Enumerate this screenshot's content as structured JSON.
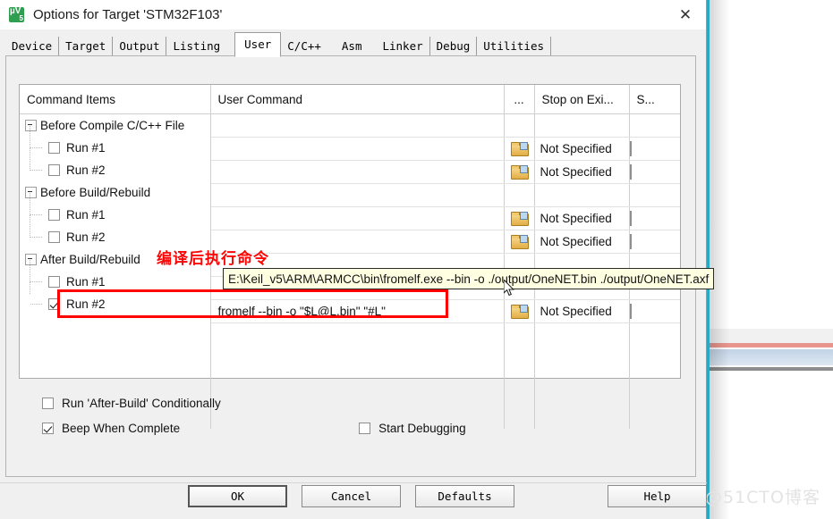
{
  "window": {
    "title": "Options for Target 'STM32F103'",
    "app_icon": "keil-uvision5-icon",
    "close_label": "✕"
  },
  "tabs": [
    {
      "label": "Device",
      "active": false
    },
    {
      "label": "Target",
      "active": false
    },
    {
      "label": "Output",
      "active": false
    },
    {
      "label": "Listing",
      "active": false
    },
    {
      "label": "User",
      "active": true
    },
    {
      "label": "C/C++",
      "active": false
    },
    {
      "label": "Asm",
      "active": false
    },
    {
      "label": "Linker",
      "active": false
    },
    {
      "label": "Debug",
      "active": false
    },
    {
      "label": "Utilities",
      "active": false
    }
  ],
  "grid": {
    "headers": {
      "command_items": "Command Items",
      "user_command": "User Command",
      "dots": "...",
      "stop_on_exit": "Stop on Exi...",
      "s_column": "S..."
    },
    "rows": [
      {
        "type": "group",
        "label": "Before Compile C/C++ File",
        "command": "",
        "stop": "",
        "has_folder": false,
        "checked": false,
        "s_checked": false
      },
      {
        "type": "child",
        "label": "Run #1",
        "command": "",
        "stop": "Not Specified",
        "has_folder": true,
        "checked": false,
        "s_checked": false
      },
      {
        "type": "child",
        "label": "Run #2",
        "command": "",
        "stop": "Not Specified",
        "has_folder": true,
        "checked": false,
        "s_checked": false
      },
      {
        "type": "group",
        "label": "Before Build/Rebuild",
        "command": "",
        "stop": "",
        "has_folder": false,
        "checked": false,
        "s_checked": false
      },
      {
        "type": "child",
        "label": "Run #1",
        "command": "",
        "stop": "Not Specified",
        "has_folder": true,
        "checked": false,
        "s_checked": false
      },
      {
        "type": "child",
        "label": "Run #2",
        "command": "",
        "stop": "Not Specified",
        "has_folder": true,
        "checked": false,
        "s_checked": false
      },
      {
        "type": "group",
        "label": "After Build/Rebuild",
        "command": "",
        "stop": "",
        "has_folder": false,
        "checked": false,
        "s_checked": false
      },
      {
        "type": "child",
        "label": "Run #1",
        "command": "",
        "stop": "",
        "has_folder": false,
        "checked": false,
        "s_checked": false
      },
      {
        "type": "child",
        "label": "Run #2",
        "command": "fromelf --bin -o \"$L@L.bin\" \"#L\"",
        "stop": "Not Specified",
        "has_folder": true,
        "checked": true,
        "s_checked": false
      }
    ]
  },
  "options": {
    "run_after_build_conditionally": {
      "label": "Run 'After-Build' Conditionally",
      "checked": false
    },
    "beep_when_complete": {
      "label": "Beep When Complete",
      "checked": true
    },
    "start_debugging": {
      "label": "Start Debugging",
      "checked": false
    }
  },
  "buttons": {
    "ok": "OK",
    "cancel": "Cancel",
    "defaults": "Defaults",
    "help": "Help"
  },
  "annotations": {
    "red_note": "编译后执行命令",
    "tooltip": "E:\\Keil_v5\\ARM\\ARMCC\\bin\\fromelf.exe --bin -o ./output/OneNET.bin  ./output/OneNET.axf"
  },
  "background": {
    "watermark": "@51CTO博客"
  },
  "colors": {
    "annotation_red": "#ff0000",
    "tooltip_bg": "#ffffe1",
    "accent_teal": "#2aa8c4",
    "folder_yellow": "#e3ad45"
  }
}
